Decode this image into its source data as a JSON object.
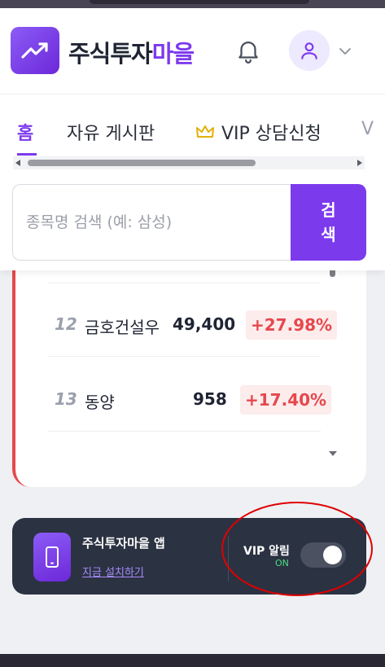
{
  "header": {
    "brand_main": "주식투자",
    "brand_accent": "마을",
    "logo_icon": "trending-up-icon",
    "notification_icon": "bell-icon",
    "profile_icon": "user-icon"
  },
  "nav": {
    "tabs": [
      {
        "label": "홈",
        "active": true
      },
      {
        "label": "자유 게시판"
      },
      {
        "label": "VIP 상담신청",
        "icon": "crown-icon"
      },
      {
        "label": "V"
      }
    ]
  },
  "search": {
    "placeholder": "종목명 검색 (예: 삼성)",
    "button_label": "검\n색"
  },
  "ranking": {
    "rows": [
      {
        "rank": "12",
        "name": "금호건설우",
        "price": "49,400",
        "change": "+27.98%"
      },
      {
        "rank": "13",
        "name": "동양",
        "price": "958",
        "change": "+17.40%"
      }
    ]
  },
  "app_banner": {
    "title": "주식투자마을 앱",
    "install_label": "지금 설치하기",
    "vip_label": "VIP 알림",
    "vip_status": "ON",
    "vip_enabled": true,
    "icon": "smartphone-icon"
  },
  "colors": {
    "accent": "#7c3aed",
    "up_red": "#e5484d",
    "banner_bg": "#2b3242",
    "on_green": "#4ade80",
    "annotation_red": "#e00000"
  }
}
